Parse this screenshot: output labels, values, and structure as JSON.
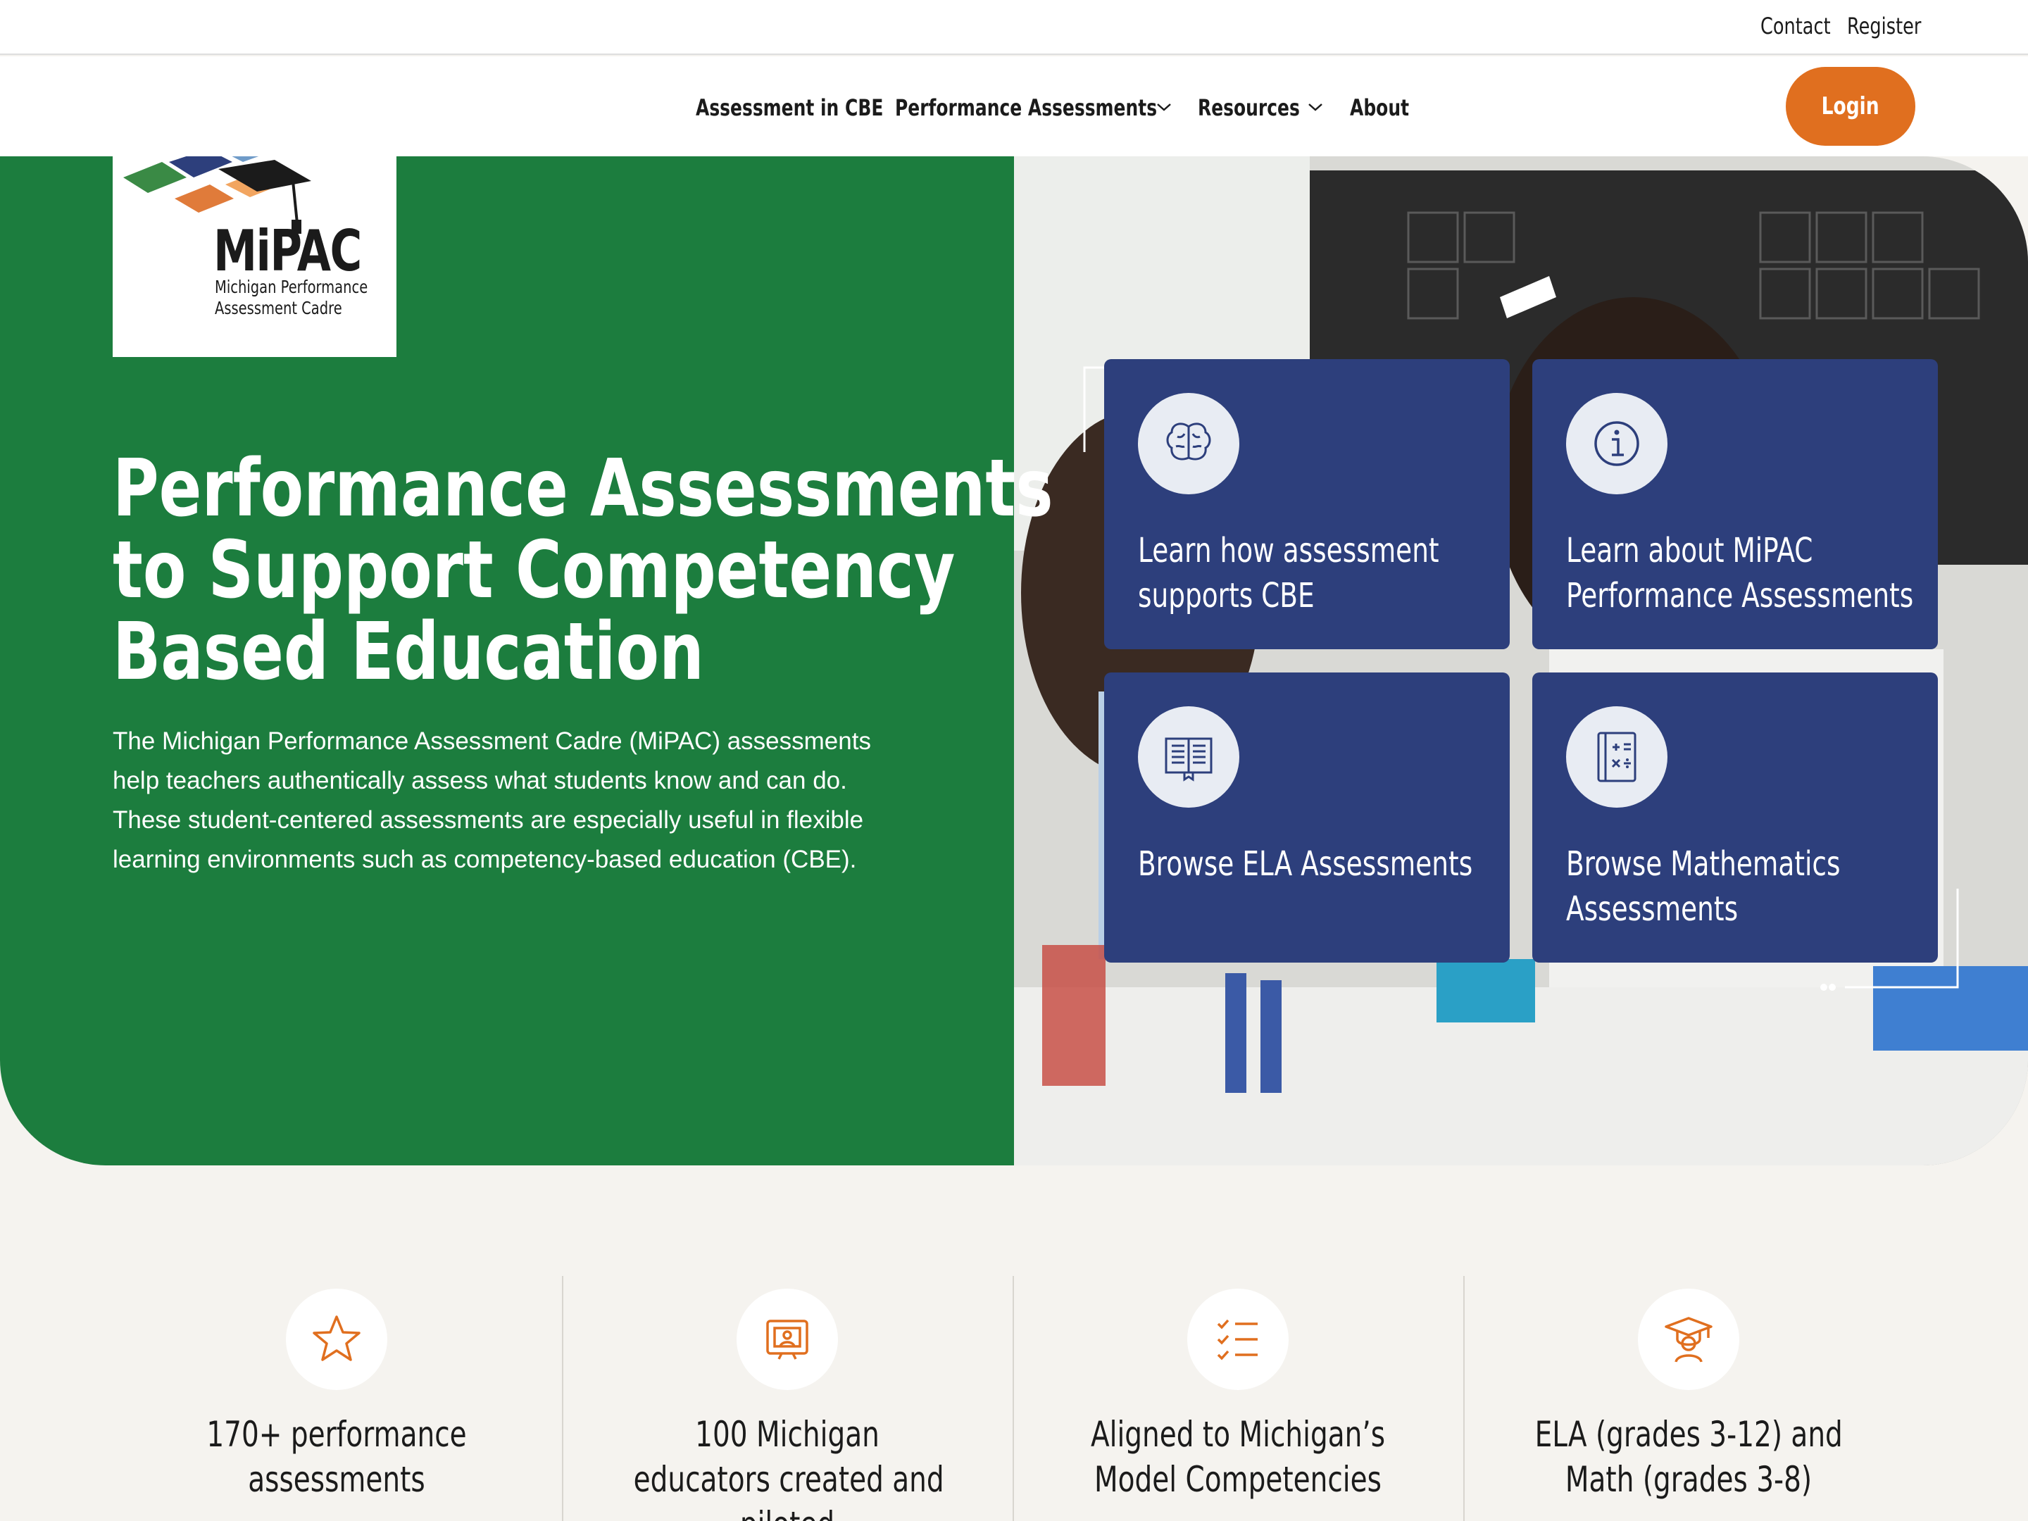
{
  "utility_nav": {
    "contact": "Contact",
    "register": "Register"
  },
  "nav": {
    "items": [
      {
        "label": "Assessment in CBE"
      },
      {
        "label": "Performance Assessments"
      },
      {
        "label": "Resources"
      },
      {
        "label": "About"
      }
    ],
    "login": "Login"
  },
  "logo": {
    "name": "MiPAC",
    "subtitle_line1": "Michigan Performance",
    "subtitle_line2": "Assessment Cadre"
  },
  "hero": {
    "title_lines": [
      "Performance Assessments",
      "to Support Competency",
      "Based Education"
    ],
    "body": "The Michigan Performance Assessment Cadre (MiPAC) assessments help teachers authentically assess what students know and can do. These student-centered assessments are especially useful in flexible learning environments such as competency-based education (CBE)."
  },
  "tiles": [
    {
      "lines": [
        "Learn how assessment",
        "supports CBE"
      ],
      "icon": "brain-icon"
    },
    {
      "lines": [
        "Learn about MiPAC",
        "Performance Assessments"
      ],
      "icon": "info-icon"
    },
    {
      "lines": [
        "Browse ELA Assessments"
      ],
      "icon": "book-icon"
    },
    {
      "lines": [
        "Browse Mathematics",
        "Assessments"
      ],
      "icon": "math-icon"
    }
  ],
  "stats": [
    {
      "lines": [
        "170+ performance",
        "assessments"
      ],
      "icon": "star-icon"
    },
    {
      "lines": [
        "100 Michigan",
        "educators created and",
        "piloted"
      ],
      "icon": "presentation-icon"
    },
    {
      "lines": [
        "Aligned to Michigan’s",
        "Model Competencies"
      ],
      "icon": "checklist-icon"
    },
    {
      "lines": [
        "ELA (grades 3-12) and",
        "Math (grades 3-8)"
      ],
      "icon": "graduate-icon"
    }
  ],
  "colors": {
    "green": "#1c7d3e",
    "navy": "#2d3f7c",
    "orange": "#e06f1f",
    "cream": "#f5f3ef"
  }
}
